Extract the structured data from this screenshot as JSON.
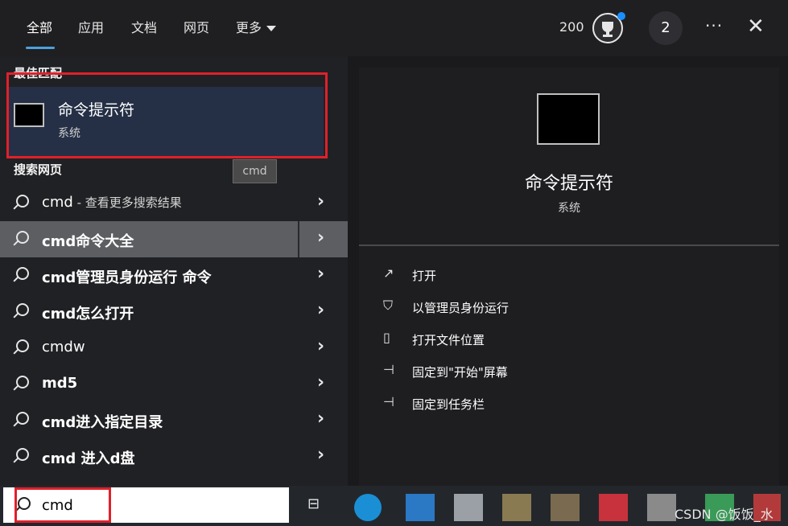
{
  "tabs": [
    "全部",
    "应用",
    "文档",
    "网页",
    "更多"
  ],
  "header": {
    "points": "200",
    "count": "2",
    "more": "···",
    "close": "✕"
  },
  "best_match": {
    "section_title": "最佳匹配",
    "name": "命令提示符",
    "subtitle": "系统",
    "tooltip": "cmd"
  },
  "web_section_title": "搜索网页",
  "results": [
    {
      "label": "cmd",
      "suffix": " - 查看更多搜索结果",
      "bold": false
    },
    {
      "label": "cmd命令大全",
      "bold": true
    },
    {
      "label": "cmd管理员身份运行 命令",
      "bold": true
    },
    {
      "label": "cmd怎么打开",
      "bold": true
    },
    {
      "label": "cmdw",
      "bold": false
    },
    {
      "label": "md5",
      "bold": true
    },
    {
      "label": "cmd进入指定目录",
      "bold": true
    },
    {
      "label": "cmd 进入d盘",
      "bold": true
    }
  ],
  "details": {
    "name": "命令提示符",
    "subtitle": "系统",
    "actions": [
      {
        "icon": "open-icon",
        "label": "打开"
      },
      {
        "icon": "shield-icon",
        "label": "以管理员身份运行"
      },
      {
        "icon": "file-location-icon",
        "label": "打开文件位置"
      },
      {
        "icon": "pin-icon",
        "label": "固定到\"开始\"屏幕"
      },
      {
        "icon": "pin-icon",
        "label": "固定到任务栏"
      }
    ]
  },
  "search": {
    "value": "cmd"
  },
  "watermark": "CSDN @饭饭_水",
  "taskbar_apps": [
    {
      "name": "edge-icon",
      "color": "#1a8fd6"
    },
    {
      "name": "app-icon-1",
      "color": "#2b78c5"
    },
    {
      "name": "app-icon-2",
      "color": "#9aa0a6"
    },
    {
      "name": "app-icon-3",
      "color": "#8a7a52"
    },
    {
      "name": "app-icon-4",
      "color": "#7a6a50"
    },
    {
      "name": "app-icon-5",
      "color": "#c8323c"
    },
    {
      "name": "app-icon-6",
      "color": "#8a8a8a"
    },
    {
      "name": "app-icon-7",
      "color": "#3a9a58"
    },
    {
      "name": "app-icon-8",
      "color": "#b33a3a"
    }
  ],
  "colors": {
    "accent": "#4ca0e0",
    "highlight": "#e0202a",
    "notify_dot": "#1a8fff"
  }
}
